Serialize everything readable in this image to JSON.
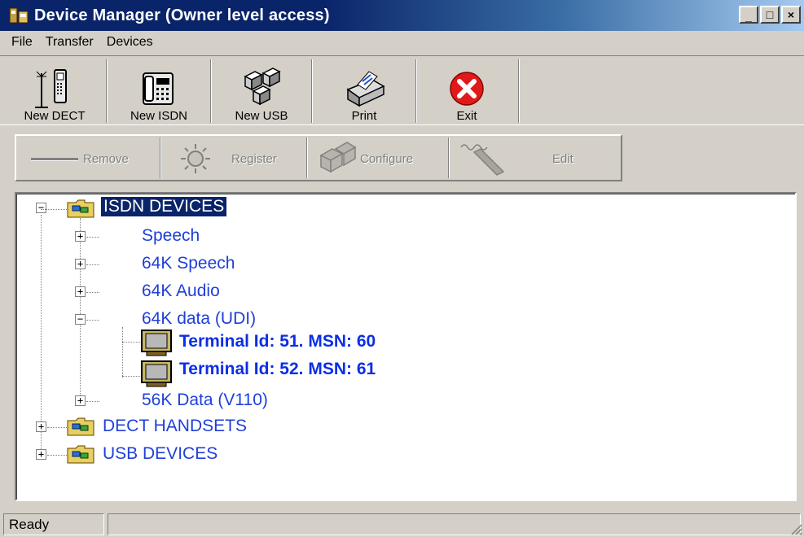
{
  "window": {
    "title": "Device Manager (Owner level access)",
    "controls": {
      "minimize": "_",
      "maximize": "□",
      "close": "×"
    }
  },
  "menu": {
    "items": [
      "File",
      "Transfer",
      "Devices"
    ]
  },
  "toolbar": {
    "buttons": [
      {
        "label": "New DECT",
        "icon": "dect-phone-icon"
      },
      {
        "label": "New ISDN",
        "icon": "isdn-phone-icon"
      },
      {
        "label": "New USB",
        "icon": "usb-devices-icon"
      },
      {
        "label": "Print",
        "icon": "printer-icon"
      },
      {
        "label": "Exit",
        "icon": "exit-icon"
      }
    ]
  },
  "action_toolbar": {
    "buttons": [
      {
        "label": "Remove",
        "icon": "remove-icon",
        "enabled": false
      },
      {
        "label": "Register",
        "icon": "register-icon",
        "enabled": false
      },
      {
        "label": "Configure",
        "icon": "configure-icon",
        "enabled": false
      },
      {
        "label": "Edit",
        "icon": "edit-icon",
        "enabled": false
      }
    ]
  },
  "tree": {
    "root": {
      "label": "ISDN DEVICES",
      "expanded": true,
      "selected": true
    },
    "isdn_children": [
      {
        "label": "Speech",
        "expanded": false
      },
      {
        "label": "64K Speech",
        "expanded": false
      },
      {
        "label": "64K Audio",
        "expanded": false
      },
      {
        "label": "64K data (UDI)",
        "expanded": true
      },
      {
        "label": "56K Data (V110)",
        "expanded": false
      }
    ],
    "terminals": [
      {
        "label": "Terminal Id: 51.  MSN: 60"
      },
      {
        "label": "Terminal Id: 52.  MSN: 61"
      }
    ],
    "other_roots": [
      {
        "label": "DECT HANDSETS",
        "expanded": false
      },
      {
        "label": "USB DEVICES",
        "expanded": false
      }
    ]
  },
  "status": {
    "text": "Ready"
  },
  "colors": {
    "titlebar": "#0a246a",
    "tree_text": "#1f3fd9",
    "selection": "#0a246a",
    "exit_red": "#e01a1a"
  }
}
